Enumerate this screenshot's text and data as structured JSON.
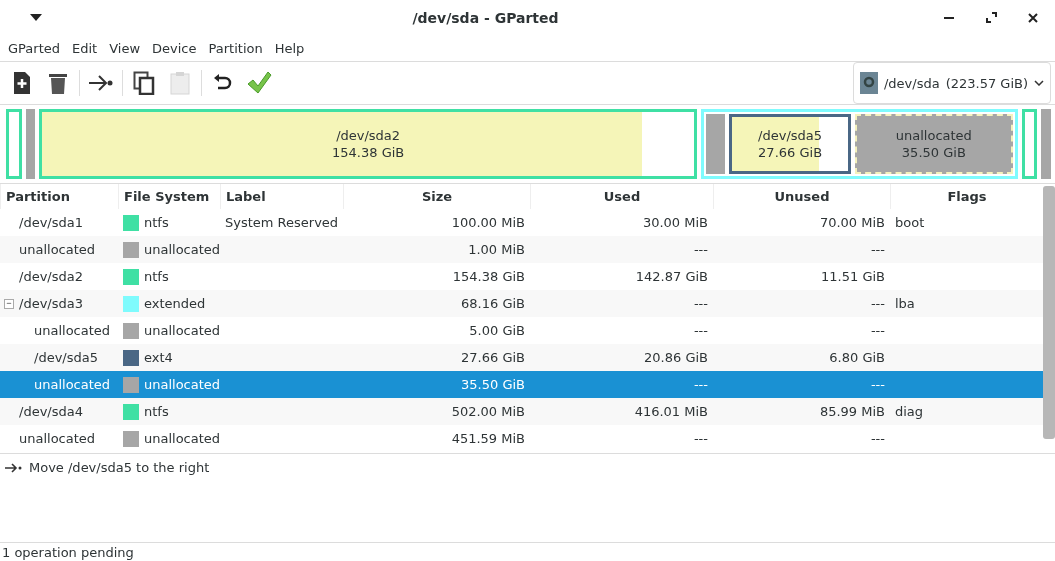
{
  "window": {
    "title": "/dev/sda - GParted"
  },
  "menu": [
    "GParted",
    "Edit",
    "View",
    "Device",
    "Partition",
    "Help"
  ],
  "toolbar": [
    {
      "kind": "new",
      "disabled": false
    },
    {
      "kind": "delete",
      "disabled": false
    },
    {
      "kind": "sep"
    },
    {
      "kind": "move",
      "disabled": false
    },
    {
      "kind": "sep"
    },
    {
      "kind": "copy",
      "disabled": false
    },
    {
      "kind": "paste",
      "disabled": true
    },
    {
      "kind": "sep"
    },
    {
      "kind": "undo",
      "disabled": false
    },
    {
      "kind": "apply",
      "disabled": false
    }
  ],
  "device": {
    "name": "/dev/sda",
    "size": "(223.57 GiB)"
  },
  "disk_map": [
    {
      "kind": "partition",
      "color": "#3fe0a4",
      "selected": false
    },
    {
      "kind": "unallocated",
      "selected": false
    },
    {
      "kind": "partition",
      "color": "#3fe0a4",
      "name": "/dev/sda2",
      "size": "154.38 GiB",
      "level": 0.92,
      "selected": false
    },
    {
      "kind": "extended",
      "color": "#7ffbfd",
      "selected": false,
      "children": [
        {
          "kind": "unallocated",
          "selected": false
        },
        {
          "kind": "partition",
          "color": "#4a6785",
          "name": "/dev/sda5",
          "size": "27.66 GiB",
          "level": 0.75,
          "selected": false
        },
        {
          "kind": "unallocated",
          "name": "unallocated",
          "size": "35.50 GiB",
          "selected": true
        }
      ]
    },
    {
      "kind": "partition",
      "color": "#3fe0a4",
      "selected": false
    },
    {
      "kind": "unallocated",
      "selected": false
    }
  ],
  "table": {
    "columns": [
      "Partition",
      "File System",
      "Label",
      "Size",
      "Used",
      "Unused",
      "Flags"
    ],
    "rows": [
      {
        "partition": "/dev/sda1",
        "file_system": "ntfs",
        "color": "#3fe0a4",
        "label": "System Reserved",
        "size": "100.00 MiB",
        "used": "30.00 MiB",
        "unused": "70.00 MiB",
        "flags": "boot",
        "selected": false
      },
      {
        "partition": "unallocated",
        "file_system": "unallocated",
        "color": "#a6a6a6",
        "size": "1.00 MiB",
        "used": "---",
        "unused": "---",
        "selected": false
      },
      {
        "partition": "/dev/sda2",
        "file_system": "ntfs",
        "color": "#3fe0a4",
        "size": "154.38 GiB",
        "used": "142.87 GiB",
        "unused": "11.51 GiB",
        "selected": false
      },
      {
        "partition": "/dev/sda3",
        "file_system": "extended",
        "color": "#7ffbfd",
        "size": "68.16 GiB",
        "used": "---",
        "unused": "---",
        "flags": "lba",
        "selected": false,
        "expanded": true,
        "expander": "−",
        "children": [
          {
            "partition": "unallocated",
            "file_system": "unallocated",
            "color": "#a6a6a6",
            "size": "5.00 GiB",
            "used": "---",
            "unused": "---",
            "selected": false
          },
          {
            "partition": "/dev/sda5",
            "file_system": "ext4",
            "color": "#4a6785",
            "size": "27.66 GiB",
            "used": "20.86 GiB",
            "unused": "6.80 GiB",
            "selected": false
          },
          {
            "partition": "unallocated",
            "file_system": "unallocated",
            "color": "#a6a6a6",
            "size": "35.50 GiB",
            "used": "---",
            "unused": "---",
            "selected": true
          }
        ]
      },
      {
        "partition": "/dev/sda4",
        "file_system": "ntfs",
        "color": "#3fe0a4",
        "size": "502.00 MiB",
        "used": "416.01 MiB",
        "unused": "85.99 MiB",
        "flags": "diag",
        "selected": false
      },
      {
        "partition": "unallocated",
        "file_system": "unallocated",
        "color": "#a6a6a6",
        "size": "451.59 MiB",
        "used": "---",
        "unused": "---",
        "selected": false
      }
    ]
  },
  "operations": [
    "Move /dev/sda5 to the right"
  ],
  "status_bar": "1 operation pending"
}
